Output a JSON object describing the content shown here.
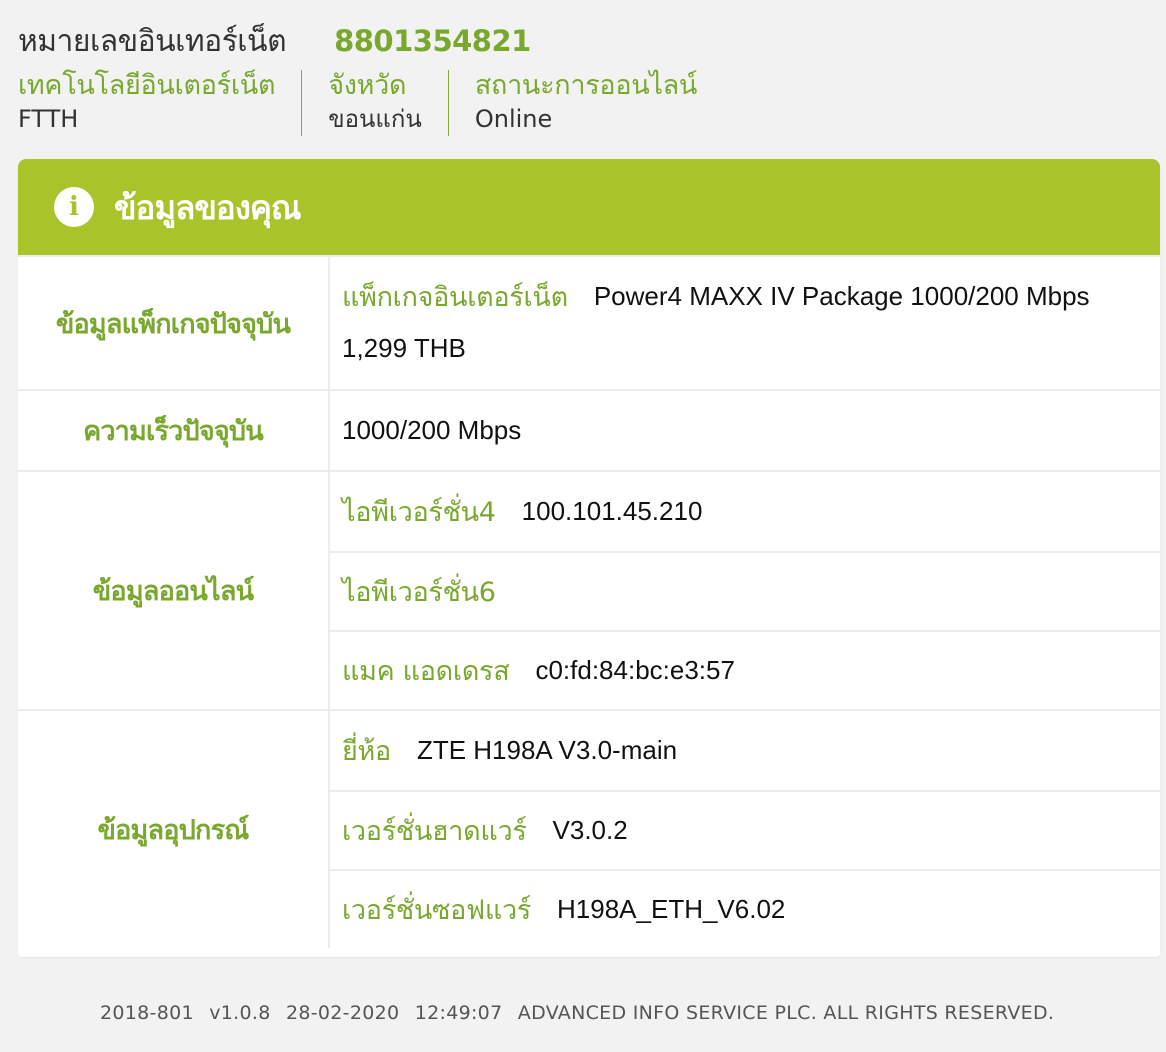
{
  "header": {
    "internet_number_label": "หมายเลขอินเทอร์เน็ต",
    "internet_number": "8801354821",
    "technology_label": "เทคโนโลยีอินเตอร์เน็ต",
    "technology_value": "FTTH",
    "province_label": "จังหวัด",
    "province_value": "ขอนแก่น",
    "online_status_label": "สถานะการออนไลน์",
    "online_status_value": "Online"
  },
  "card": {
    "title": "ข้อมูลของคุณ",
    "info_icon_glyph": "i",
    "package": {
      "section_label": "ข้อมูลแพ็กเกจปัจจุบัน",
      "package_label": "แพ็กเกจอินเตอร์เน็ต",
      "package_name": "Power4 MAXX IV Package 1000/200 Mbps",
      "price": "1,299 THB"
    },
    "speed": {
      "section_label": "ความเร็วปัจจุบัน",
      "value": "1000/200 Mbps"
    },
    "online": {
      "section_label": "ข้อมูลออนไลน์",
      "ipv4_label": "ไอพีเวอร์ชั่น4",
      "ipv4_value": "100.101.45.210",
      "ipv6_label": "ไอพีเวอร์ชั่น6",
      "ipv6_value": "",
      "mac_label": "แมค แอดเดรส",
      "mac_value": "c0:fd:84:bc:e3:57"
    },
    "device": {
      "section_label": "ข้อมูลอุปกรณ์",
      "brand_label": "ยี่ห้อ",
      "brand_value": "ZTE H198A V3.0-main",
      "hardware_label": "เวอร์ชั่นฮาดแวร์",
      "hardware_value": "V3.0.2",
      "software_label": "เวอร์ชั่นซอฟแวร์",
      "software_value": "H198A_ETH_V6.02"
    }
  },
  "footer": {
    "build": "2018-801",
    "version": "v1.0.8",
    "date": "28-02-2020",
    "time": "12:49:07",
    "copyright": "ADVANCED INFO SERVICE PLC. ALL RIGHTS RESERVED."
  },
  "colors": {
    "accent_green": "#a9c42b",
    "label_green": "#7aa82e"
  }
}
